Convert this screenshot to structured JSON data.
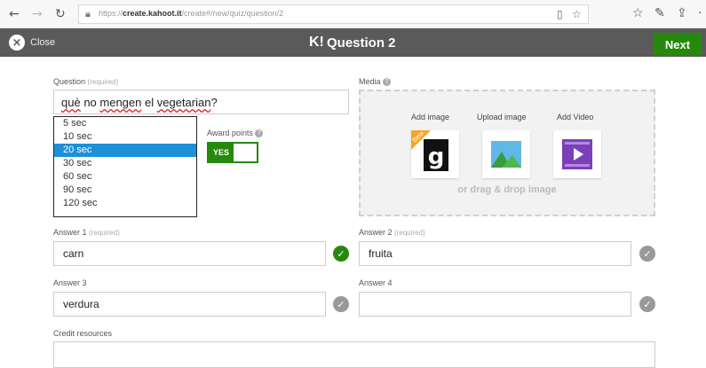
{
  "browser": {
    "url_prefix": "https://",
    "url_host": "create.kahoot.it",
    "url_path": "/create#/new/quiz/question/2"
  },
  "header": {
    "close_label": "Close",
    "logo": "K!",
    "title": "Question 2",
    "next_label": "Next"
  },
  "question": {
    "label": "Question",
    "required": "(required)",
    "text_part1": "què",
    "text_part2": " no ",
    "text_part3": "mengen",
    "text_part4": " el ",
    "text_part5": "vegetarian",
    "text_part6": "?"
  },
  "time_limit": {
    "options": [
      "5 sec",
      "10 sec",
      "20 sec",
      "30 sec",
      "60 sec",
      "90 sec",
      "120 sec"
    ],
    "selected": "20 sec"
  },
  "award_points": {
    "label": "Award points",
    "toggle": "YES"
  },
  "media": {
    "label": "Media",
    "add_image": "Add image",
    "upload_image": "Upload image",
    "add_video": "Add Video",
    "beta": "Beta",
    "drop_text": "or drag & drop image"
  },
  "answers": [
    {
      "label": "Answer 1",
      "required": "(required)",
      "value": "carn",
      "correct": true
    },
    {
      "label": "Answer 2",
      "required": "(required)",
      "value": "fruita",
      "correct": false
    },
    {
      "label": "Answer 3",
      "required": "",
      "value": "verdura",
      "correct": false
    },
    {
      "label": "Answer 4",
      "required": "",
      "value": "",
      "correct": false
    }
  ],
  "credit": {
    "label": "Credit resources"
  },
  "colors": {
    "header": "#5a5a5a",
    "accent_green": "#26890c",
    "selected_blue": "#1e90d8"
  }
}
